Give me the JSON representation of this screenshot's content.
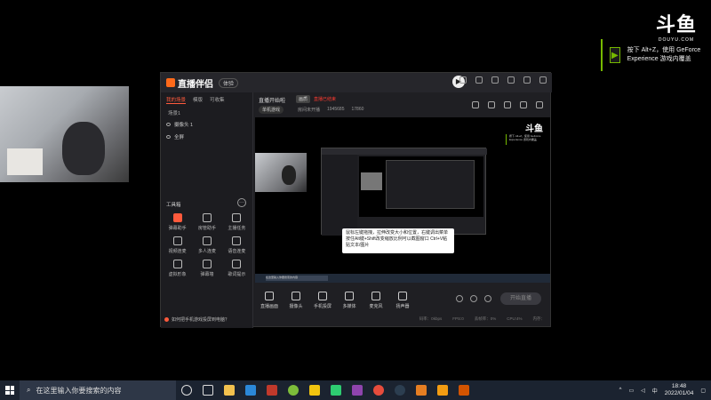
{
  "overlay": {
    "douyu_logo": "斗鱼",
    "douyu_sub": "DOUYU.COM",
    "nvidia_toast": "按下 Alt+Z，使用 GeForce Experience 游戏内覆盖"
  },
  "app": {
    "title": "直播伴侣",
    "version": "体验",
    "scene_tabs": [
      "我的场景",
      "模版",
      "可收集"
    ],
    "scene_name": "场景1",
    "sources": [
      "摄像头 1",
      "全屏"
    ],
    "tools_title": "工具箱",
    "tools": [
      "弹幕助手",
      "房管助手",
      "主播任务",
      "视频连麦",
      "多人连麦",
      "语音连麦",
      "虚拟形象",
      "弹幕墙",
      "歌词提示"
    ],
    "footer_hint": "如何把手机游戏投屏到电脑？",
    "room": {
      "title": "直播开始啦",
      "tag": "画质",
      "status": "直播已结束",
      "category": "单机游戏",
      "meta": [
        "房间未开播",
        "1945685",
        "17860"
      ]
    },
    "preview_tooltip": "鼠标左键拖拽，拉伸改变大小和位置，右键调出菜单 按住Alt键+Shift改变缩放比例可以截图窗口 Ctrl+V粘贴文本/图片",
    "preview_search": "在这里输入你要搜索的内容",
    "bottom_tools": [
      "直播画面",
      "摄像头",
      "手机投屏",
      "多媒体",
      "麦克风",
      "扬声器"
    ],
    "start_live": "开始直播",
    "status_bar": [
      "码率：0kbps",
      "FPS:0",
      "丢帧率：0%",
      "CPU:4%",
      "内存："
    ]
  },
  "taskbar": {
    "search_placeholder": "在这里输入你要搜索的内容",
    "time": "18:48",
    "date": "2022/01/04",
    "ime": "中"
  }
}
